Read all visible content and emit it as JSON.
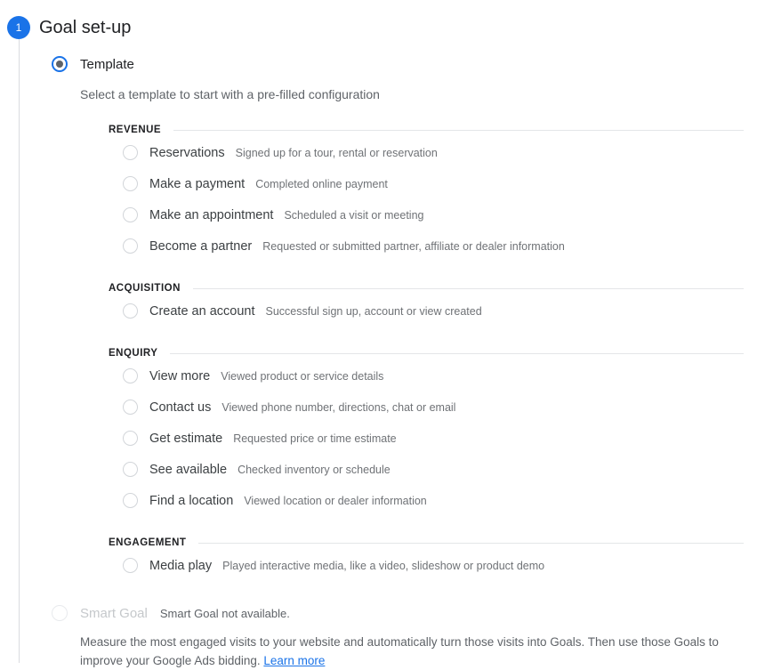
{
  "step": {
    "number": "1",
    "title": "Goal set-up"
  },
  "template_option": {
    "label": "Template",
    "helper": "Select a template to start with a pre-filled configuration",
    "selected": true
  },
  "groups": [
    {
      "title": "REVENUE",
      "items": [
        {
          "label": "Reservations",
          "description": "Signed up for a tour, rental or reservation"
        },
        {
          "label": "Make a payment",
          "description": "Completed online payment"
        },
        {
          "label": "Make an appointment",
          "description": "Scheduled a visit or meeting"
        },
        {
          "label": "Become a partner",
          "description": "Requested or submitted partner, affiliate or dealer information"
        }
      ]
    },
    {
      "title": "ACQUISITION",
      "items": [
        {
          "label": "Create an account",
          "description": "Successful sign up, account or view created"
        }
      ]
    },
    {
      "title": "ENQUIRY",
      "items": [
        {
          "label": "View more",
          "description": "Viewed product or service details"
        },
        {
          "label": "Contact us",
          "description": "Viewed phone number, directions, chat or email"
        },
        {
          "label": "Get estimate",
          "description": "Requested price or time estimate"
        },
        {
          "label": "See available",
          "description": "Checked inventory or schedule"
        },
        {
          "label": "Find a location",
          "description": "Viewed location or dealer information"
        }
      ]
    },
    {
      "title": "ENGAGEMENT",
      "items": [
        {
          "label": "Media play",
          "description": "Played interactive media, like a video, slideshow or product demo"
        }
      ]
    }
  ],
  "smart_goal": {
    "label": "Smart Goal",
    "note": "Smart Goal not available.",
    "description": "Measure the most engaged visits to your website and automatically turn those visits into Goals. Then use those Goals to improve your Google Ads bidding. ",
    "link_label": "Learn more",
    "disabled": true
  },
  "colors": {
    "accent": "#1a73e8",
    "text_primary": "#202124",
    "text_secondary": "#5f6368",
    "rule": "#e4e6e8",
    "radio_border": "#bdc1c6"
  }
}
